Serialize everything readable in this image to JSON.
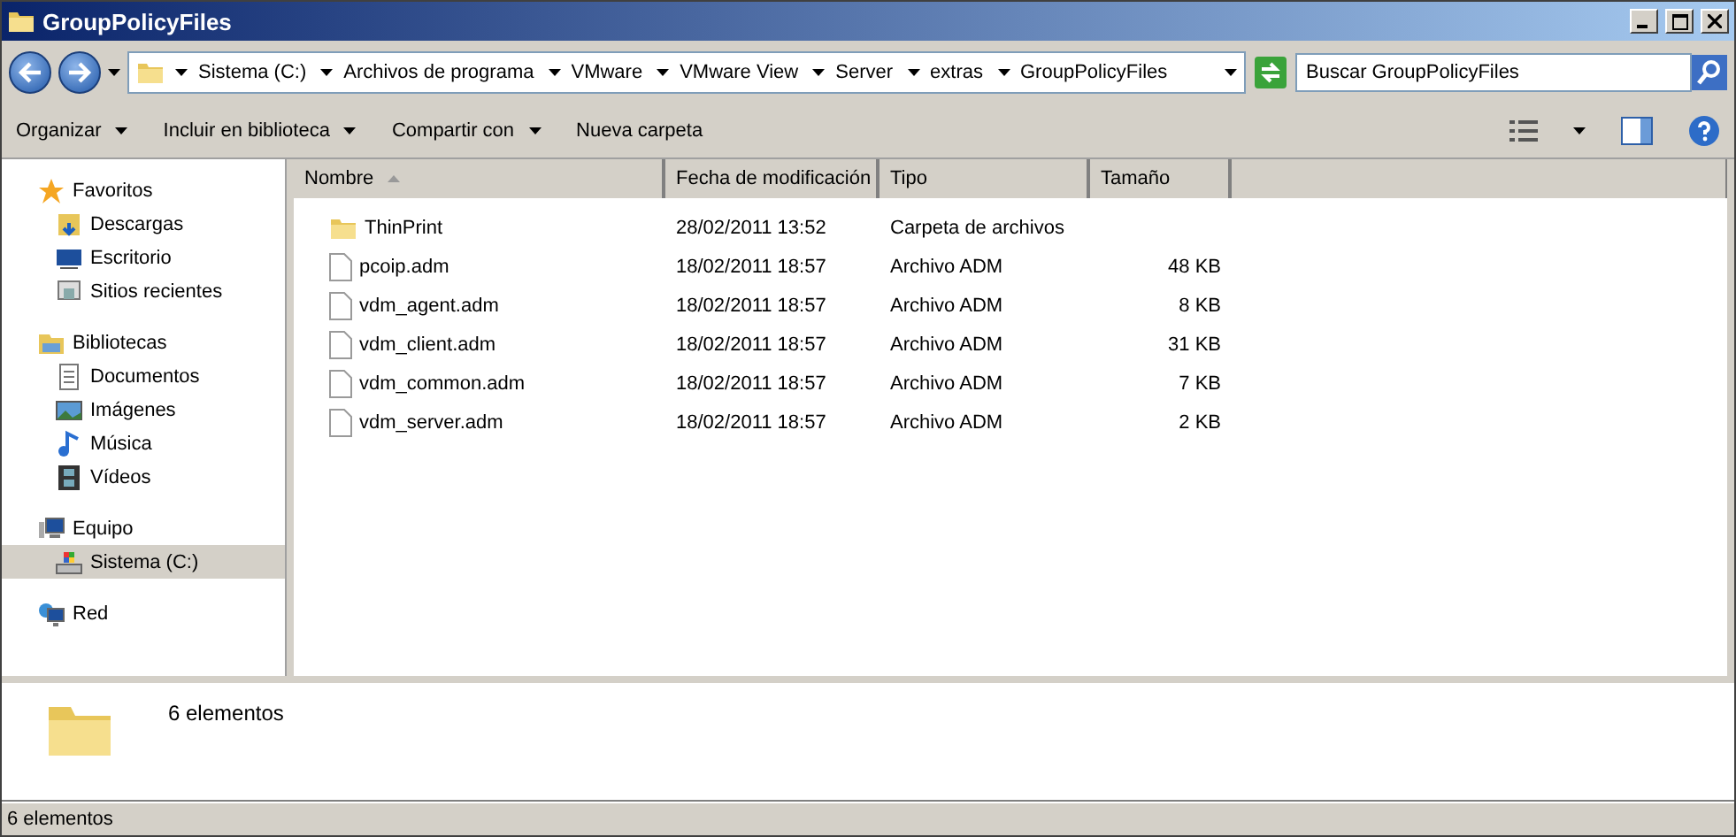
{
  "window": {
    "title": "GroupPolicyFiles"
  },
  "breadcrumb": [
    "Sistema (C:)",
    "Archivos de programa",
    "VMware",
    "VMware View",
    "Server",
    "extras",
    "GroupPolicyFiles"
  ],
  "search": {
    "placeholder": "Buscar GroupPolicyFiles"
  },
  "commands": [
    {
      "label": "Organizar",
      "dropdown": true
    },
    {
      "label": "Incluir en biblioteca",
      "dropdown": true
    },
    {
      "label": "Compartir con",
      "dropdown": true
    },
    {
      "label": "Nueva carpeta",
      "dropdown": false
    }
  ],
  "sidebar": [
    {
      "label": "Favoritos",
      "kind": "star",
      "selected": false,
      "children": [
        {
          "label": "Descargas",
          "kind": "download",
          "selected": false
        },
        {
          "label": "Escritorio",
          "kind": "desktop",
          "selected": false
        },
        {
          "label": "Sitios recientes",
          "kind": "recent",
          "selected": false
        }
      ]
    },
    {
      "label": "Bibliotecas",
      "kind": "library",
      "selected": false,
      "children": [
        {
          "label": "Documentos",
          "kind": "document",
          "selected": false
        },
        {
          "label": "Imágenes",
          "kind": "image",
          "selected": false
        },
        {
          "label": "Música",
          "kind": "music",
          "selected": false
        },
        {
          "label": "Vídeos",
          "kind": "video",
          "selected": false
        }
      ]
    },
    {
      "label": "Equipo",
      "kind": "computer",
      "selected": false,
      "children": [
        {
          "label": "Sistema (C:)",
          "kind": "drive",
          "selected": true
        }
      ]
    },
    {
      "label": "Red",
      "kind": "network",
      "selected": false
    }
  ],
  "table": {
    "columns": [
      "Nombre",
      "Fecha de modificación",
      "Tipo",
      "Tamaño"
    ],
    "rows": [
      {
        "kind": "folder",
        "name": "ThinPrint",
        "date": "28/02/2011 13:52",
        "type": "Carpeta de archivos"
      },
      {
        "kind": "file",
        "name": "pcoip.adm",
        "date": "18/02/2011 18:57",
        "type": "Archivo ADM",
        "size": "48 KB"
      },
      {
        "kind": "file",
        "name": "vdm_agent.adm",
        "date": "18/02/2011 18:57",
        "type": "Archivo ADM",
        "size": "8 KB"
      },
      {
        "kind": "file",
        "name": "vdm_client.adm",
        "date": "18/02/2011 18:57",
        "type": "Archivo ADM",
        "size": "31 KB"
      },
      {
        "kind": "file",
        "name": "vdm_common.adm",
        "date": "18/02/2011 18:57",
        "type": "Archivo ADM",
        "size": "7 KB"
      },
      {
        "kind": "file",
        "name": "vdm_server.adm",
        "date": "18/02/2011 18:57",
        "type": "Archivo ADM",
        "size": "2 KB"
      }
    ]
  },
  "details": {
    "text": "6 elementos"
  },
  "status_bar": {
    "text": "6 elementos"
  }
}
